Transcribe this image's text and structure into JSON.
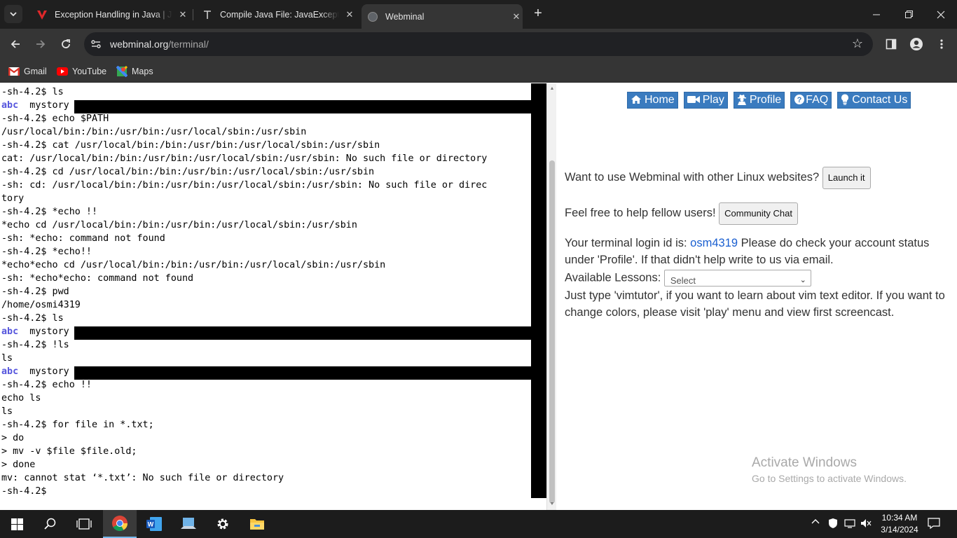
{
  "browser": {
    "tabs": [
      {
        "title": "Exception Handling in Java | Jav",
        "active": false
      },
      {
        "title": "Compile Java File: JavaException",
        "active": false
      },
      {
        "title": "Webminal",
        "active": true
      }
    ],
    "url_host": "webminal.org",
    "url_path": "/terminal/",
    "bookmarks": [
      "Gmail",
      "YouTube",
      "Maps"
    ]
  },
  "terminal": {
    "lines": [
      "-sh-4.2$ ls",
      "abc  mystory",
      "-sh-4.2$ echo $PATH",
      "/usr/local/bin:/bin:/usr/bin:/usr/local/sbin:/usr/sbin",
      "-sh-4.2$ cat /usr/local/bin:/bin:/usr/bin:/usr/local/sbin:/usr/sbin",
      "cat: /usr/local/bin:/bin:/usr/bin:/usr/local/sbin:/usr/sbin: No such file or directory",
      "-sh-4.2$ cd /usr/local/bin:/bin:/usr/bin:/usr/local/sbin:/usr/sbin",
      "-sh: cd: /usr/local/bin:/bin:/usr/bin:/usr/local/sbin:/usr/sbin: No such file or direc",
      "tory",
      "-sh-4.2$ *echo !!",
      "*echo cd /usr/local/bin:/bin:/usr/bin:/usr/local/sbin:/usr/sbin",
      "-sh: *echo: command not found",
      "-sh-4.2$ *echo!!",
      "*echo*echo cd /usr/local/bin:/bin:/usr/bin:/usr/local/sbin:/usr/sbin",
      "-sh: *echo*echo: command not found",
      "-sh-4.2$ pwd",
      "/home/osmi4319",
      "-sh-4.2$ ls",
      "abc  mystory",
      "-sh-4.2$ !ls",
      "ls",
      "abc  mystory",
      "-sh-4.2$ echo !!",
      "echo ls",
      "ls",
      "-sh-4.2$ for file in *.txt;",
      "> do",
      "> mv -v $file $file.old;",
      "> done",
      "mv: cannot stat ‘*.txt’: No such file or directory",
      "-sh-4.2$"
    ]
  },
  "panel": {
    "nav": [
      {
        "label": "Home",
        "icon": "home-icon"
      },
      {
        "label": "Play",
        "icon": "video-camera-icon"
      },
      {
        "label": "Profile",
        "icon": "user-secret-icon"
      },
      {
        "label": "FAQ",
        "icon": "question-circle-icon"
      },
      {
        "label": "Contact Us",
        "icon": "lightbulb-icon"
      }
    ],
    "other_sites_text": "Want to use Webminal with other Linux websites?",
    "launch_button": "Launch it",
    "help_text": "Feel free to help fellow users!",
    "community_button": "Community Chat",
    "login_prefix": "Your terminal login id is:",
    "login_id": "osm4319",
    "login_suffix": "Please do check your account status under 'Profile'. If that didn't help write to us via email.",
    "lessons_label": "Available Lessons:",
    "lessons_selected": "Select",
    "vimtutor_text": "Just type 'vimtutor', if you want to learn about vim text editor. If you want to change colors, please visit 'play' menu and view first screencast."
  },
  "watermark": {
    "line1": "Activate Windows",
    "line2": "Go to Settings to activate Windows."
  },
  "taskbar": {
    "time": "10:34 AM",
    "date": "3/14/2024"
  }
}
